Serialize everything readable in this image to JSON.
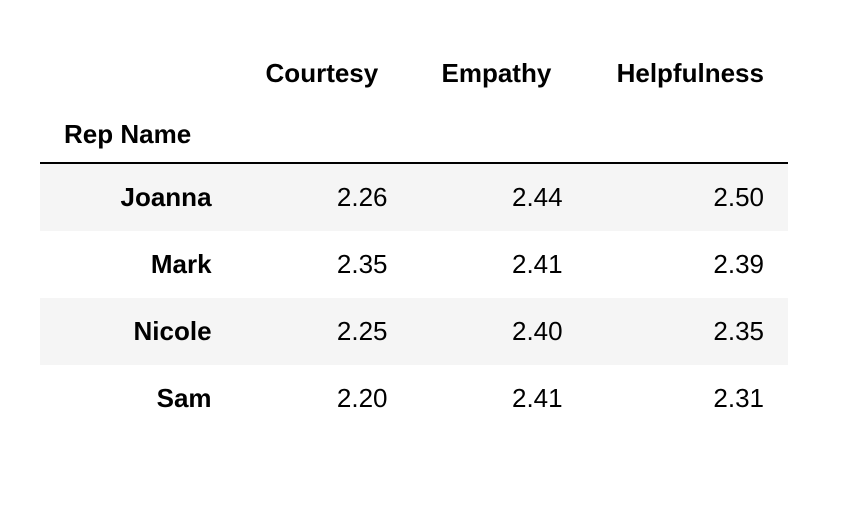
{
  "table": {
    "row_header_label": "Rep Name",
    "columns": [
      "Courtesy",
      "Empathy",
      "Helpfulness"
    ],
    "rows": [
      {
        "name": "Joanna",
        "values": [
          "2.26",
          "2.44",
          "2.50"
        ]
      },
      {
        "name": "Mark",
        "values": [
          "2.35",
          "2.41",
          "2.39"
        ]
      },
      {
        "name": "Nicole",
        "values": [
          "2.25",
          "2.40",
          "2.35"
        ]
      },
      {
        "name": "Sam",
        "values": [
          "2.20",
          "2.41",
          "2.31"
        ]
      }
    ]
  },
  "chart_data": {
    "type": "table",
    "title": "",
    "row_header": "Rep Name",
    "columns": [
      "Courtesy",
      "Empathy",
      "Helpfulness"
    ],
    "series": [
      {
        "name": "Joanna",
        "values": [
          2.26,
          2.44,
          2.5
        ]
      },
      {
        "name": "Mark",
        "values": [
          2.35,
          2.41,
          2.39
        ]
      },
      {
        "name": "Nicole",
        "values": [
          2.25,
          2.4,
          2.35
        ]
      },
      {
        "name": "Sam",
        "values": [
          2.2,
          2.41,
          2.31
        ]
      }
    ]
  }
}
